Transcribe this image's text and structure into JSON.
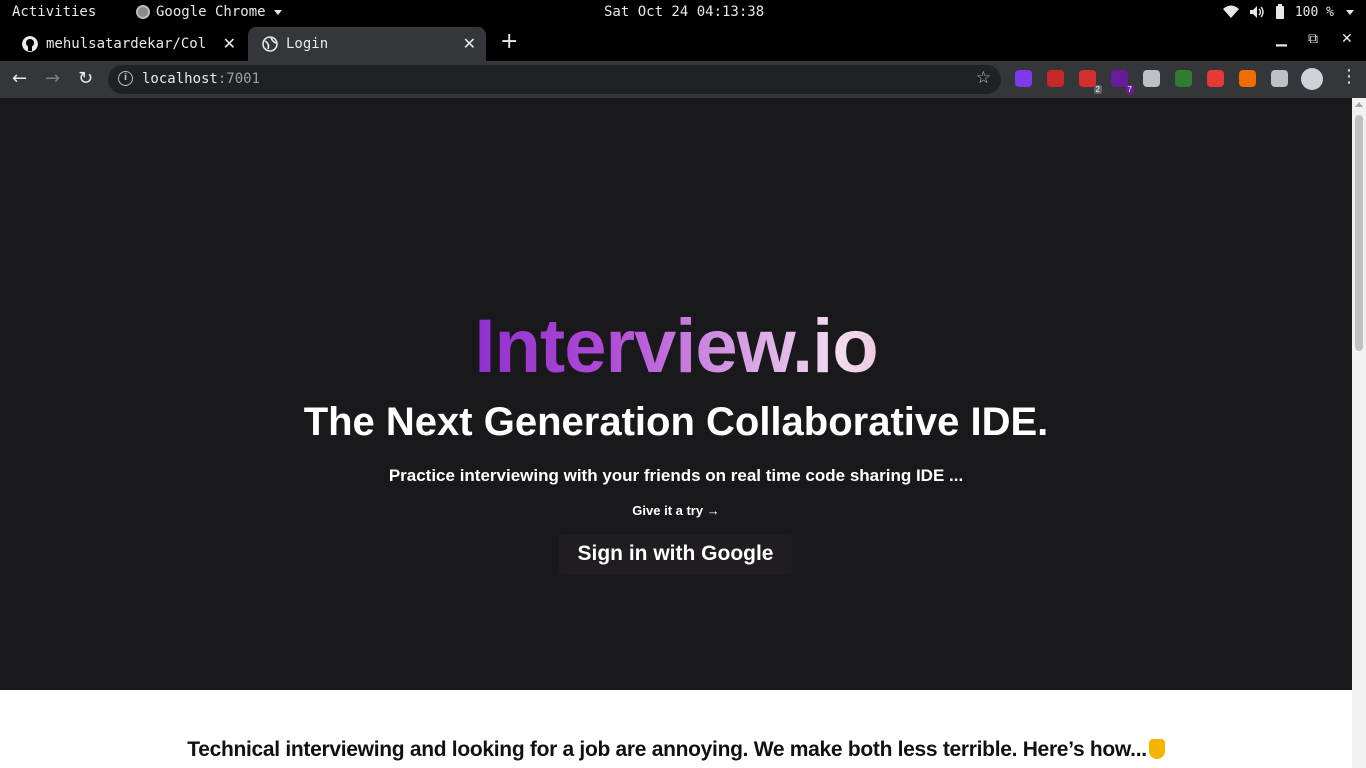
{
  "os_bar": {
    "activities": "Activities",
    "app_name": "Google Chrome",
    "clock": "Sat Oct 24 04:13:38",
    "battery": "100 %"
  },
  "tabs": [
    {
      "title": "mehulsatardekar/Col",
      "favicon": "github-icon"
    },
    {
      "title": "Login",
      "favicon": "globe-icon"
    }
  ],
  "toolbar": {
    "url_host": "localhost",
    "url_port": ":7001",
    "extensions": [
      {
        "name": "purple-chat-extension-icon",
        "color": "#7c3aed"
      },
      {
        "name": "red-book-extension-icon",
        "color": "#c62828"
      },
      {
        "name": "adblock-extension-icon",
        "color": "#d32f2f",
        "badge": "2"
      },
      {
        "name": "purple-cube-extension-icon",
        "color": "#6a1b9a",
        "badge": "7"
      },
      {
        "name": "react-devtools-icon",
        "color": "#bdc1c6"
      },
      {
        "name": "green-h-extension-icon",
        "color": "#2e7d32"
      },
      {
        "name": "red-translate-extension-icon",
        "color": "#e53935"
      },
      {
        "name": "fire-extension-icon",
        "color": "#ef6c00"
      },
      {
        "name": "puzzle-extensions-icon",
        "color": "#bdc1c6"
      }
    ]
  },
  "page": {
    "brand": "Interview.io",
    "headline": "The Next Generation Collaborative IDE.",
    "subheadline": "Practice interviewing with your friends on real time code sharing IDE ...",
    "try_link": "Give it a try",
    "signin_button": "Sign in with Google",
    "lower_text": "Technical interviewing and looking for a job are annoying. We make both less terrible. Here’s how..."
  },
  "colors": {
    "hero_bg": "#19181a",
    "brand_gradient": [
      "#1e3adb",
      "#6f17c9",
      "#b04ad6",
      "#f2dcef",
      "#e783a8",
      "#c9145c"
    ]
  }
}
